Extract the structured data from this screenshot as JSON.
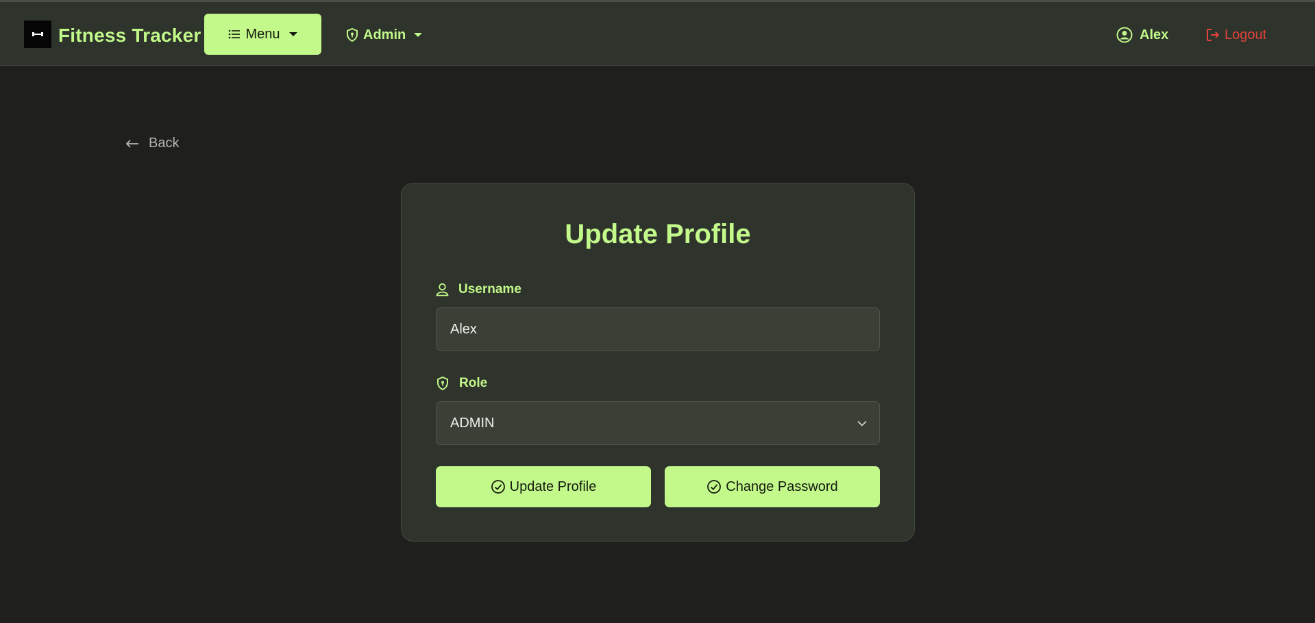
{
  "navbar": {
    "brand_title": "Fitness Tracker",
    "brand_logo": "dumbbell-icon",
    "menu_label": "Menu",
    "admin_label": "Admin",
    "user_label": "Alex",
    "logout_label": "Logout"
  },
  "page": {
    "back_label": "Back"
  },
  "form": {
    "title": "Update Profile",
    "username_label": "Username",
    "username_value": "Alex",
    "role_label": "Role",
    "role_value": "ADMIN",
    "update_button": "Update Profile",
    "password_button": "Change Password"
  },
  "colors": {
    "accent": "#c2f98a",
    "background": "#1f1f1d",
    "surface": "#2e332b",
    "logout": "#e1443b"
  }
}
